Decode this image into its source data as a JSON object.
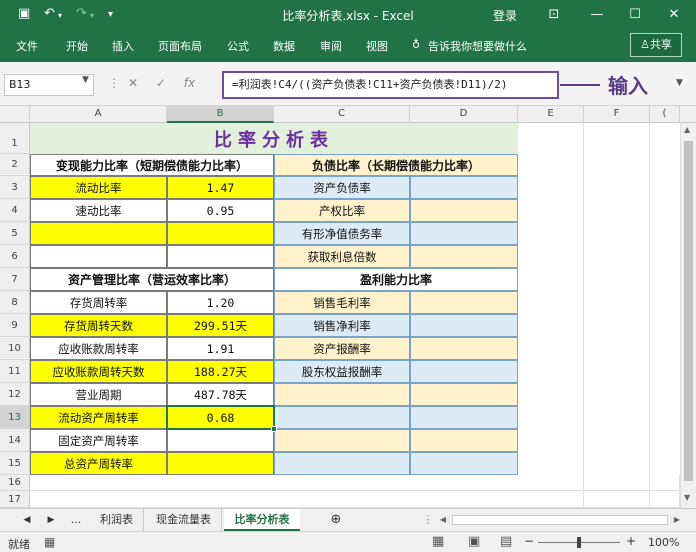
{
  "window": {
    "title": "比率分析表.xlsx - Excel",
    "login": "登录"
  },
  "qat": {
    "undo_glyph": "↶",
    "redo_glyph": "↷",
    "save_glyph": "🖫",
    "more_glyph": "▾"
  },
  "ribbon": {
    "tabs": [
      "文件",
      "开始",
      "插入",
      "页面布局",
      "公式",
      "数据",
      "审阅",
      "视图"
    ],
    "tell_me": "告诉我你想要做什么",
    "share": "共享"
  },
  "formula_bar": {
    "name_box": "B13",
    "formula": "=利润表!C4/((资产负债表!C11+资产负债表!D11)/2)",
    "annotation": "输入"
  },
  "columns": [
    "A",
    "B",
    "C",
    "D",
    "E",
    "F"
  ],
  "rows": [
    "1",
    "2",
    "3",
    "4",
    "5",
    "6",
    "7",
    "8",
    "9",
    "10",
    "11",
    "12",
    "13",
    "14",
    "15",
    "16",
    "17"
  ],
  "cells": {
    "title": "比率分析表",
    "a2": "变现能力比率（短期偿债能力比率）",
    "c2": "负债比率（长期偿债能力比率）",
    "a3": "流动比率",
    "b3": "1.47",
    "c3": "资产负债率",
    "a4": "速动比率",
    "b4": "0.95",
    "c4": "产权比率",
    "c5": "有形净值债务率",
    "c6": "获取利息倍数",
    "a7": "资产管理比率（营运效率比率）",
    "c7": "盈利能力比率",
    "a8": "存货周转率",
    "b8": "1.20",
    "c8": "销售毛利率",
    "a9": "存货周转天数",
    "b9": "299.51天",
    "c9": "销售净利率",
    "a10": "应收账款周转率",
    "b10": "1.91",
    "c10": "资产报酬率",
    "a11": "应收账款周转天数",
    "b11": "188.27天",
    "c11": "股东权益报酬率",
    "a12": "营业周期",
    "b12": "487.78天",
    "a13": "流动资产周转率",
    "b13": "0.68",
    "a14": "固定资产周转率",
    "a15": "总资产周转率"
  },
  "sheet_tabs": {
    "more": "...",
    "tabs": [
      "利润表",
      "现金流量表",
      "比率分析表"
    ],
    "add": "⊕"
  },
  "status": {
    "ready": "就绪",
    "zoom": "100%"
  },
  "colors": {
    "green": "#217346",
    "yellow": "#ffff00",
    "light_green": "#e2efda",
    "light_blue": "#ddebf7",
    "light_tan": "#fff2cc",
    "purple": "#6b2fa0"
  }
}
